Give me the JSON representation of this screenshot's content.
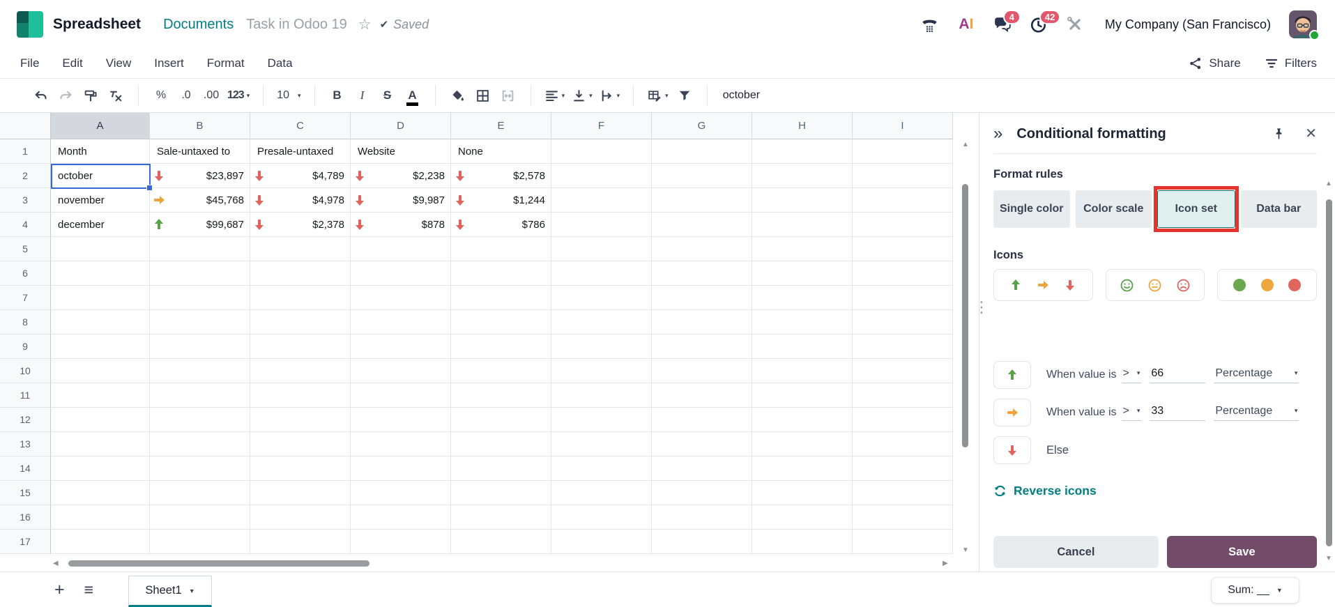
{
  "colors": {
    "accent_teal": "#017e84",
    "save_plum": "#714b67",
    "icon_green": "#55a245",
    "icon_orange": "#f0a23b",
    "icon_red": "#e0635c",
    "badge_red": "#e4566a",
    "selection_blue": "#3569d6",
    "annotation_red": "#e5342e"
  },
  "icons_glyphs": {
    "star": "☆",
    "check": "✔",
    "caret": "▾",
    "caret_small": "▼",
    "collapse": "»",
    "close": "✕",
    "plus": "+",
    "hamburger": "≡",
    "grip": "⋮",
    "up_arrow": "▲",
    "down_arrow": "▼",
    "left_arrow": "◀",
    "right_arrow": "▶",
    "ai_a": "A",
    "ai_i": "I"
  },
  "topbar": {
    "app": "Spreadsheet",
    "nav_documents": "Documents",
    "doc_title": "Task in Odoo 19",
    "saved": "Saved",
    "badges": {
      "chat": "4",
      "activities": "42"
    },
    "company": "My Company (San Francisco)"
  },
  "menubar": {
    "items": [
      "File",
      "Edit",
      "View",
      "Insert",
      "Format",
      "Data"
    ],
    "share": "Share",
    "filters": "Filters"
  },
  "toolbar": {
    "number": {
      "percent": "%",
      "dec0": ".0",
      "dec00": ".00",
      "fmt123": "123"
    },
    "font_size": "10",
    "bold": "B",
    "italic": "I",
    "strike": "S",
    "underline": "A",
    "formula": "october"
  },
  "grid": {
    "col_headers": [
      "A",
      "B",
      "C",
      "D",
      "E",
      "F",
      "G",
      "H",
      "I"
    ],
    "row_count": 17,
    "selected_cell": "A2",
    "selected_column": "A",
    "header_row": {
      "A": "Month",
      "B": "Sale-untaxed to",
      "C": "Presale-untaxed",
      "D": "Website",
      "E": "None"
    },
    "data_rows": [
      {
        "row": 2,
        "month": "october",
        "values": [
          {
            "icon": "down",
            "amount": "$23,897"
          },
          {
            "icon": "down",
            "amount": "$4,789"
          },
          {
            "icon": "down",
            "amount": "$2,238"
          },
          {
            "icon": "down",
            "amount": "$2,578"
          }
        ]
      },
      {
        "row": 3,
        "month": "november",
        "values": [
          {
            "icon": "right",
            "amount": "$45,768"
          },
          {
            "icon": "down",
            "amount": "$4,978"
          },
          {
            "icon": "down",
            "amount": "$9,987"
          },
          {
            "icon": "down",
            "amount": "$1,244"
          }
        ]
      },
      {
        "row": 4,
        "month": "december",
        "values": [
          {
            "icon": "up",
            "amount": "$99,687"
          },
          {
            "icon": "down",
            "amount": "$2,378"
          },
          {
            "icon": "down",
            "amount": "$878"
          },
          {
            "icon": "down",
            "amount": "$786"
          }
        ]
      }
    ]
  },
  "panel": {
    "title": "Conditional formatting",
    "format_rules_label": "Format rules",
    "rule_types": [
      "Single color",
      "Color scale",
      "Icon set",
      "Data bar"
    ],
    "selected_rule_type": "Icon set",
    "icons_label": "Icons",
    "rules": [
      {
        "icon": "up",
        "label": "When value is",
        "operator": ">",
        "value": "66",
        "unit": "Percentage"
      },
      {
        "icon": "right",
        "label": "When value is",
        "operator": ">",
        "value": "33",
        "unit": "Percentage"
      },
      {
        "icon": "down",
        "label": "Else"
      }
    ],
    "reverse_label": "Reverse icons",
    "cancel_label": "Cancel",
    "save_label": "Save"
  },
  "bottombar": {
    "sheet_name": "Sheet1",
    "sum_label": "Sum: __"
  }
}
